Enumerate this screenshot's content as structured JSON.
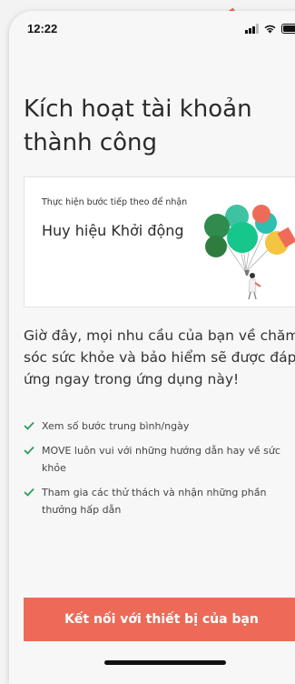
{
  "status_bar": {
    "time": "12:22",
    "icons": [
      "cellular-signal-icon",
      "wifi-icon",
      "battery-icon"
    ]
  },
  "title": "Kích hoạt tài khoản thành công",
  "card": {
    "subtitle": "Thực hiện bước tiếp theo để nhận",
    "badge_name": "Huy hiệu Khởi động",
    "illustration": "balloons-illustration"
  },
  "body_text": "Giờ đây, mọi nhu cầu của bạn về chăm sóc sức khỏe và bảo hiểm sẽ được đáp ứng ngay trong ứng dụng này!",
  "benefits": [
    "Xem số bước trung bình/ngày",
    "MOVE luôn vui với những hướng dẫn hay về sức khỏe",
    "Tham gia các thử thách và nhận những phần thưởng hấp dẫn"
  ],
  "connect_button_label": "Kết nối với thiết bị của bạn",
  "colors": {
    "accent": "#ee6a58",
    "check": "#2a9d5c",
    "background": "#f7f7f7"
  }
}
